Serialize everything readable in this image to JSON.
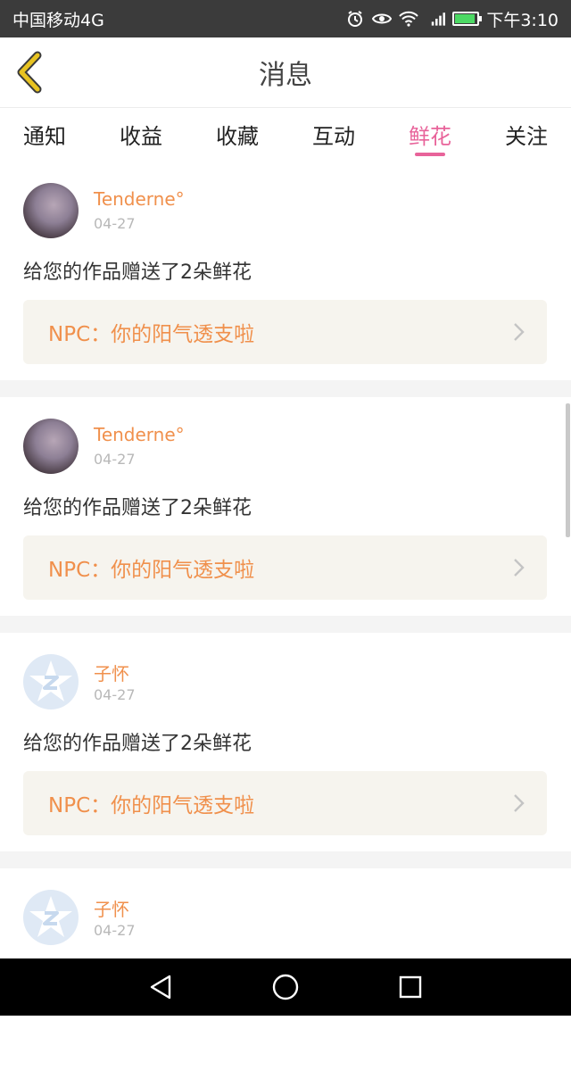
{
  "status_bar": {
    "carrier": "中国移动4G",
    "time": "下午3:10",
    "icons": [
      "alarm-icon",
      "eye-icon",
      "wifi-icon",
      "signal-4g-icon",
      "battery-icon"
    ],
    "battery_level": 0.85
  },
  "header": {
    "title": "消息",
    "back_icon": "chevron-left-icon",
    "accent_color": "#e8c321"
  },
  "tabs": {
    "items": [
      "通知",
      "收益",
      "收藏",
      "互动",
      "鲜花",
      "关注"
    ],
    "active": "鲜花",
    "active_color": "#e8639a"
  },
  "messages": [
    {
      "user": "Tenderne°",
      "date": "04-27",
      "text": "给您的作品赠送了2朵鲜花",
      "work": "NPC：你的阳气透支啦",
      "avatar": "photo"
    },
    {
      "user": "Tenderne°",
      "date": "04-27",
      "text": "给您的作品赠送了2朵鲜花",
      "work": "NPC：你的阳气透支啦",
      "avatar": "photo"
    },
    {
      "user": "子怀",
      "date": "04-27",
      "text": "给您的作品赠送了2朵鲜花",
      "work": "NPC：你的阳气透支啦",
      "avatar": "default"
    },
    {
      "user": "子怀",
      "date": "04-27",
      "avatar": "default"
    }
  ],
  "colors": {
    "username": "#f0904c",
    "card_background": "#f6f4ee",
    "separator": "#f4f4f4"
  },
  "nav_bar": {
    "buttons": [
      "back-triangle-icon",
      "home-circle-icon",
      "recents-square-icon"
    ]
  }
}
